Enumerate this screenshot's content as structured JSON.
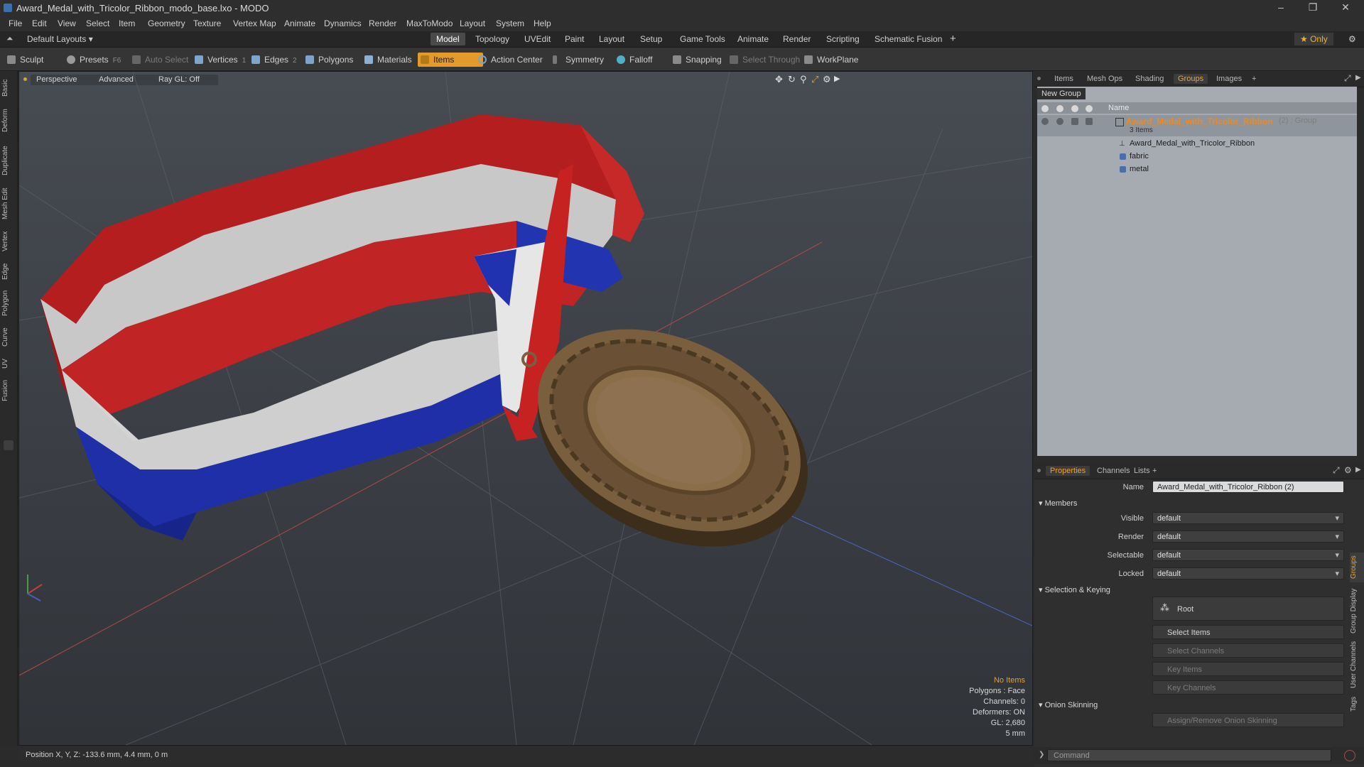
{
  "window": {
    "title": "Award_Medal_with_Tricolor_Ribbon_modo_base.lxo - MODO",
    "minimize": "–",
    "maximize": "❐",
    "close": "✕"
  },
  "menu": [
    "File",
    "Edit",
    "View",
    "Select",
    "Item",
    "Geometry",
    "Texture",
    "Vertex Map",
    "Animate",
    "Dynamics",
    "Render",
    "MaxToModo",
    "Layout",
    "System",
    "Help"
  ],
  "layoutbar": {
    "layout_menu": "Default Layouts ▾",
    "tabs": [
      "Model",
      "Topology",
      "UVEdit",
      "Paint",
      "Layout",
      "Setup",
      "Game Tools",
      "Animate",
      "Render",
      "Scripting",
      "Schematic Fusion"
    ],
    "active_tab": "Model",
    "add": "+",
    "only": "★  Only",
    "gear": "⚙"
  },
  "toolbar": {
    "sculpt": "Sculpt",
    "presets": "Presets",
    "presets_key": "F6",
    "auto_select": "Auto Select",
    "vertices": "Vertices",
    "vertices_n": "1",
    "edges": "Edges",
    "edges_n": "2",
    "polygons": "Polygons",
    "materials": "Materials",
    "items": "Items",
    "action_center": "Action Center",
    "symmetry": "Symmetry",
    "falloff": "Falloff",
    "snapping": "Snapping",
    "select_through": "Select Through",
    "workplane": "WorkPlane"
  },
  "left_tabs": [
    "Basic",
    "Deform",
    "Duplicate",
    "Mesh Edit",
    "Vertex",
    "Edge",
    "Polygon",
    "Curve",
    "UV",
    "Fusion"
  ],
  "viewport": {
    "perspective": "Perspective",
    "advanced": "Advanced",
    "raygl": "Ray GL: Off",
    "info": {
      "no_items": "No Items",
      "polygons": "Polygons : Face",
      "channels": "Channels: 0",
      "deformers": "Deformers: ON",
      "gl": "GL: 2,680",
      "scale": "5 mm"
    }
  },
  "status": {
    "position": "Position X, Y, Z:  -133.6 mm, 4.4 mm, 0 m"
  },
  "top_panel": {
    "tabs": [
      "Items",
      "Mesh Ops",
      "Shading",
      "Groups",
      "Images"
    ],
    "active_tab": "Groups",
    "add": "+",
    "new_group": "New Group",
    "col_name": "Name",
    "group": {
      "name": "Award_Medal_with_Tricolor_Ribbon",
      "suffix": "(2) : Group",
      "count": "3 Items"
    },
    "children": [
      "Award_Medal_with_Tricolor_Ribbon",
      "fabric",
      "metal"
    ]
  },
  "bottom_panel": {
    "tabs": [
      "Properties",
      "Channels",
      "Lists"
    ],
    "active_tab": "Properties",
    "add": "+",
    "name_label": "Name",
    "name_value": "Award_Medal_with_Tricolor_Ribbon (2)",
    "members_section": "Members",
    "visible_label": "Visible",
    "visible_value": "default",
    "render_label": "Render",
    "render_value": "default",
    "selectable_label": "Selectable",
    "selectable_value": "default",
    "locked_label": "Locked",
    "locked_value": "default",
    "selkey_section": "Selection & Keying",
    "root": "Root",
    "select_items": "Select Items",
    "select_channels": "Select Channels",
    "key_items": "Key Items",
    "key_channels": "Key Channels",
    "onion_section": "Onion Skinning",
    "assign_onion": "Assign/Remove Onion Skinning",
    "side_tabs": [
      "Groups",
      "Group Display",
      "User Channels",
      "Tags"
    ]
  },
  "command": {
    "placeholder": "Command"
  }
}
